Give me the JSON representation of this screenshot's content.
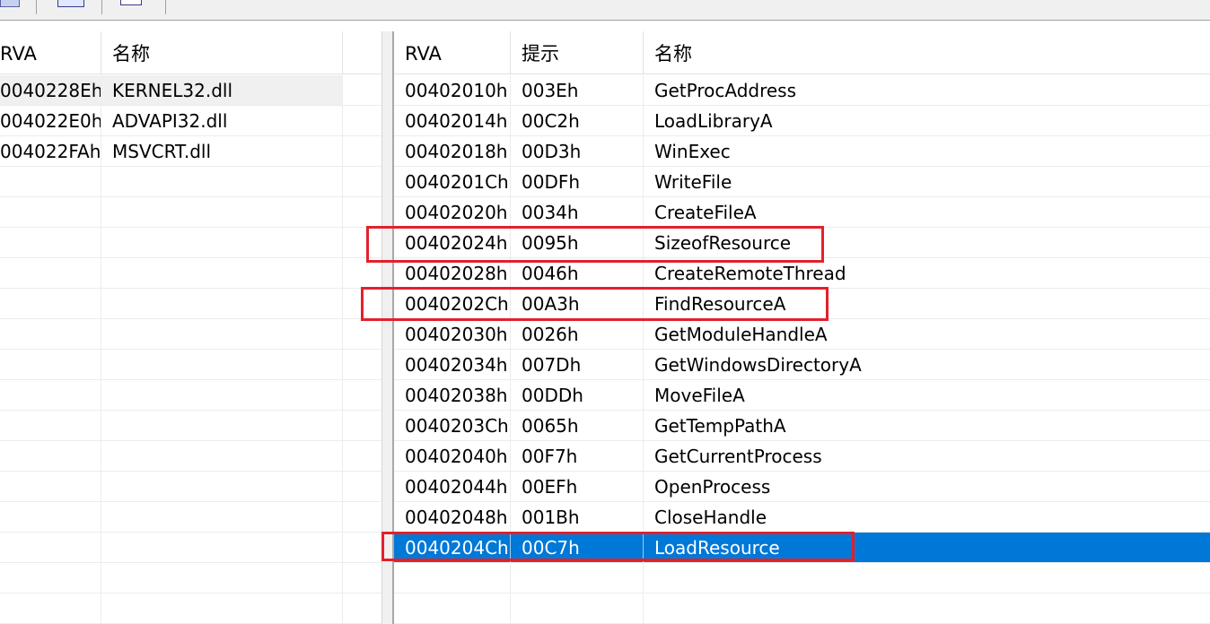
{
  "accent_color": "#0078d7",
  "highlight_color": "#e3202a",
  "toolbar": {
    "icons": [
      "properties-icon",
      "window-icon",
      "panel-icon"
    ]
  },
  "dll_list": {
    "headers": {
      "rva": "RVA",
      "name": "名称"
    },
    "rows": [
      {
        "rva": "0040228Eh",
        "name": "KERNEL32.dll"
      },
      {
        "rva": "004022E0h",
        "name": "ADVAPI32.dll"
      },
      {
        "rva": "004022FAh",
        "name": "MSVCRT.dll"
      }
    ]
  },
  "imports": {
    "headers": {
      "rva": "RVA",
      "hint": "提示",
      "name": "名称"
    },
    "rows": [
      {
        "rva": "00402010h",
        "hint": "003Eh",
        "name": "GetProcAddress"
      },
      {
        "rva": "00402014h",
        "hint": "00C2h",
        "name": "LoadLibraryA"
      },
      {
        "rva": "00402018h",
        "hint": "00D3h",
        "name": "WinExec"
      },
      {
        "rva": "0040201Ch",
        "hint": "00DFh",
        "name": "WriteFile"
      },
      {
        "rva": "00402020h",
        "hint": "0034h",
        "name": "CreateFileA"
      },
      {
        "rva": "00402024h",
        "hint": "0095h",
        "name": "SizeofResource"
      },
      {
        "rva": "00402028h",
        "hint": "0046h",
        "name": "CreateRemoteThread"
      },
      {
        "rva": "0040202Ch",
        "hint": "00A3h",
        "name": "FindResourceA"
      },
      {
        "rva": "00402030h",
        "hint": "0026h",
        "name": "GetModuleHandleA"
      },
      {
        "rva": "00402034h",
        "hint": "007Dh",
        "name": "GetWindowsDirectoryA"
      },
      {
        "rva": "00402038h",
        "hint": "00DDh",
        "name": "MoveFileA"
      },
      {
        "rva": "0040203Ch",
        "hint": "0065h",
        "name": "GetTempPathA"
      },
      {
        "rva": "00402040h",
        "hint": "00F7h",
        "name": "GetCurrentProcess"
      },
      {
        "rva": "00402044h",
        "hint": "00EFh",
        "name": "OpenProcess"
      },
      {
        "rva": "00402048h",
        "hint": "001Bh",
        "name": "CloseHandle"
      },
      {
        "rva": "0040204Ch",
        "hint": "00C7h",
        "name": "LoadResource"
      }
    ]
  }
}
